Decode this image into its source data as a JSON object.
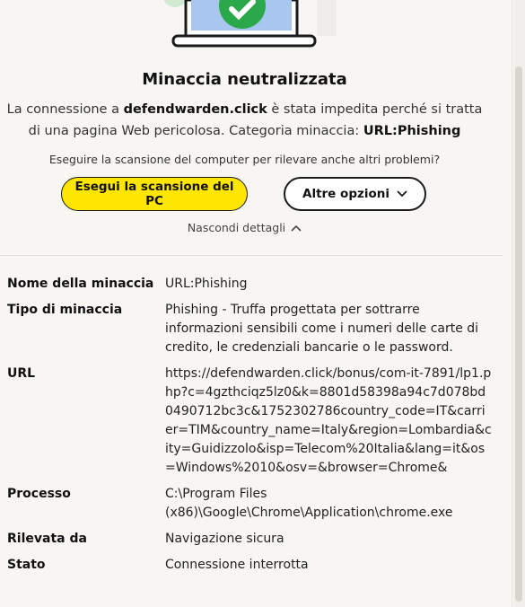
{
  "title": "Minaccia neutralizzata",
  "description": {
    "prefix": "La connessione a ",
    "domain": "defendwarden.click",
    "middle": " è stata impedita perché si tratta di una pagina Web pericolosa. Categoria minaccia: ",
    "category": "URL:Phishing"
  },
  "hint": "Eseguire la scansione del computer per rilevare anche altri problemi?",
  "buttons": {
    "scan": "Esegui la scansione del PC",
    "more": "Altre opzioni"
  },
  "toggle_label": "Nascondi dettagli",
  "colors": {
    "accent": "#ffe600",
    "success": "#2ba84a",
    "screen": "#a9c6ef"
  },
  "details": [
    {
      "label": "Nome della minaccia",
      "value": "URL:Phishing"
    },
    {
      "label": "Tipo di minaccia",
      "value": "Phishing - Truffa progettata per sottrarre informazioni sensibili come i numeri delle carte di credito, le credenziali bancarie o le password."
    },
    {
      "label": "URL",
      "value": "https://defendwarden.click/bonus/com-it-7891/lp1.php?c=4gzthciqz5lz0&k=8801d58398a94c7d078bd0490712bc3c&1752302786country_code=IT&carrier=TIM&country_name=Italy&region=Lombardia&city=Guidizzolo&isp=Telecom%20Italia&lang=it&os=Windows%2010&osv=&browser=Chrome&"
    },
    {
      "label": "Processo",
      "value": "C:\\Program Files (x86)\\Google\\Chrome\\Application\\chrome.exe"
    },
    {
      "label": "Rilevata da",
      "value": "Navigazione sicura"
    },
    {
      "label": "Stato",
      "value": "Connessione interrotta"
    }
  ]
}
